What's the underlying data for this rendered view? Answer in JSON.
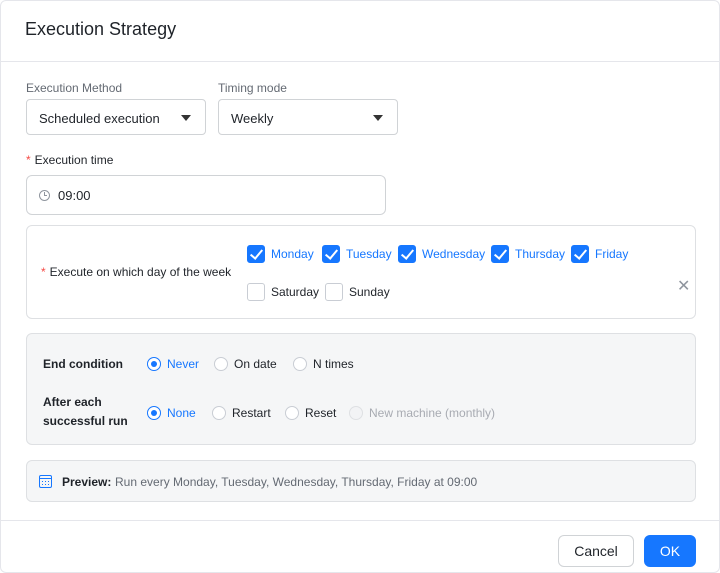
{
  "dialog": {
    "title": "Execution Strategy",
    "execution_method": {
      "label": "Execution Method",
      "value": "Scheduled execution"
    },
    "timing_mode": {
      "label": "Timing mode",
      "value": "Weekly"
    },
    "execution_time": {
      "required_mark": "*",
      "label": "Execution time",
      "value": "09:00"
    },
    "days": {
      "required_mark": "*",
      "label": "Execute on which day of the week",
      "items": [
        {
          "label": "Monday",
          "checked": true
        },
        {
          "label": "Tuesday",
          "checked": true
        },
        {
          "label": "Wednesday",
          "checked": true
        },
        {
          "label": "Thursday",
          "checked": true
        },
        {
          "label": "Friday",
          "checked": true
        },
        {
          "label": "Saturday",
          "checked": false
        },
        {
          "label": "Sunday",
          "checked": false
        }
      ]
    },
    "end_condition": {
      "label": "End condition",
      "options": [
        {
          "label": "Never",
          "selected": true
        },
        {
          "label": "On date",
          "selected": false
        },
        {
          "label": "N times",
          "selected": false
        }
      ]
    },
    "after_run": {
      "label_line1": "After each",
      "label_line2": "successful run",
      "options": [
        {
          "label": "None",
          "selected": true
        },
        {
          "label": "Restart",
          "selected": false
        },
        {
          "label": "Reset",
          "selected": false
        },
        {
          "label": "New machine (monthly)",
          "selected": false,
          "disabled": true
        }
      ]
    },
    "preview": {
      "label": "Preview:",
      "text": "Run every Monday, Tuesday, Wednesday, Thursday, Friday at 09:00"
    },
    "buttons": {
      "cancel": "Cancel",
      "ok": "OK"
    }
  },
  "colors": {
    "accent": "#1677ff",
    "required": "#f54a45",
    "panel_bg": "#f5f6f7"
  }
}
